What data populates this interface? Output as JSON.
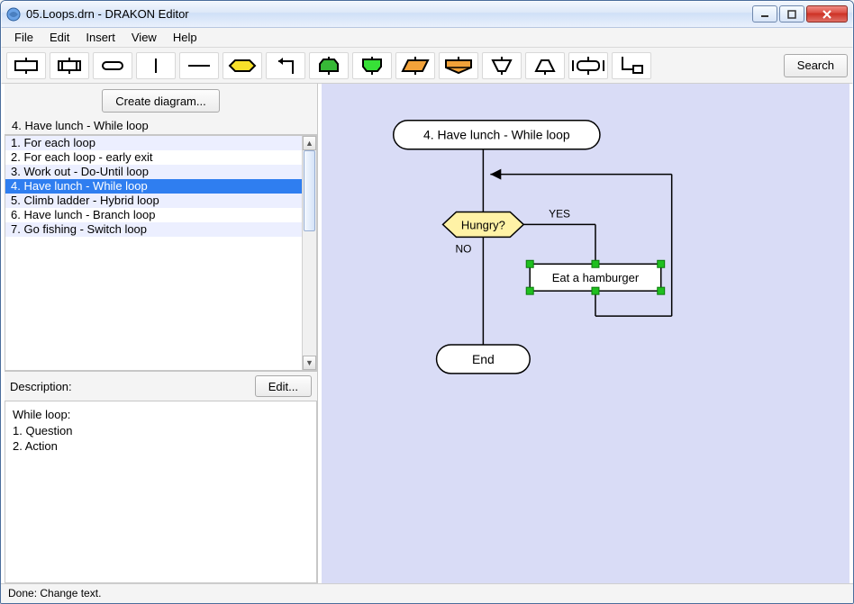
{
  "window": {
    "title": "05.Loops.drn - DRAKON Editor"
  },
  "menu": {
    "file": "File",
    "edit": "Edit",
    "insert": "Insert",
    "view": "View",
    "help": "Help"
  },
  "toolbar": {
    "search_label": "Search",
    "create_label": "Create diagram...",
    "icons": [
      "action-box",
      "subprogram-box",
      "terminator-oval",
      "vline",
      "hline",
      "question-hex",
      "arrow-up-left",
      "begin-loop",
      "end-loop",
      "parallelogram",
      "shelf-down",
      "cup-down",
      "cap-up",
      "rect-side-bars",
      "bracket-connector"
    ]
  },
  "sidebar": {
    "current": "4. Have lunch - While loop",
    "items": [
      "1. For each loop",
      "2. For each loop - early exit",
      "3. Work out - Do-Until loop",
      "4. Have lunch - While loop",
      "5. Climb ladder - Hybrid loop",
      "6. Have lunch - Branch loop",
      "7. Go fishing - Switch loop"
    ],
    "selected_index": 3,
    "description_label": "Description:",
    "edit_label": "Edit...",
    "description_text": "While loop:\n1. Question\n2. Action"
  },
  "diagram": {
    "title_node": "4. Have lunch - While loop",
    "question_node": "Hungry?",
    "yes_label": "YES",
    "no_label": "NO",
    "action_node": "Eat a hamburger",
    "end_node": "End"
  },
  "status": {
    "text": "Done: Change text."
  },
  "colors": {
    "canvas_bg": "#d9dcf6",
    "question_fill": "#fff2a6",
    "action_fill": "#ffffff",
    "handle": "#1fbf1f"
  }
}
